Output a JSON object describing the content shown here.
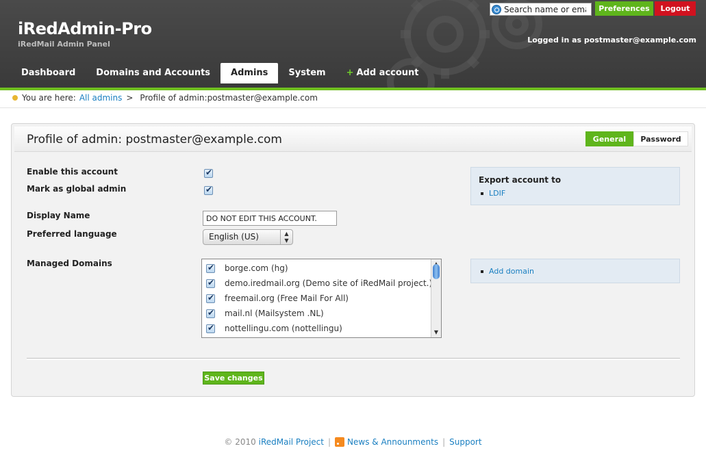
{
  "header": {
    "title": "iRedAdmin-Pro",
    "subtitle": "iRedMail Admin Panel",
    "search_placeholder": "Search name or email",
    "preferences_label": "Preferences",
    "logout_label": "Logout",
    "logged_in_text": "Logged in as postmaster@example.com"
  },
  "nav": {
    "items": [
      {
        "label": "Dashboard"
      },
      {
        "label": "Domains and Accounts"
      },
      {
        "label": "Admins"
      },
      {
        "label": "System"
      },
      {
        "label": "Add account"
      }
    ],
    "active": "Admins"
  },
  "breadcrumb": {
    "prefix": "You are here:",
    "link": "All admins",
    "separator": ">",
    "current": "Profile of admin:postmaster@example.com"
  },
  "panel": {
    "title": "Profile of admin: postmaster@example.com",
    "tabs": {
      "general": "General",
      "password": "Password"
    },
    "fields": {
      "enable_label": "Enable this account",
      "global_admin_label": "Mark as global admin",
      "display_name_label": "Display Name",
      "display_name_value": "DO NOT EDIT THIS ACCOUNT.",
      "language_label": "Preferred language",
      "language_value": "English (US)",
      "managed_domains_label": "Managed Domains"
    },
    "domains": [
      "borge.com (hg)",
      "demo.iredmail.org (Demo site of iRedMail project.)",
      "freemail.org (Free Mail For All)",
      "mail.nl (Mailsystem .NL)",
      "nottellingu.com (nottellingu)"
    ],
    "export": {
      "title": "Export account to",
      "link": "LDIF"
    },
    "add_domain": "Add domain",
    "save_label": "Save changes"
  },
  "footer": {
    "copyright": "© 2010",
    "project": "iRedMail Project",
    "news": "News & Announments",
    "support": "Support",
    "sep": "|"
  }
}
